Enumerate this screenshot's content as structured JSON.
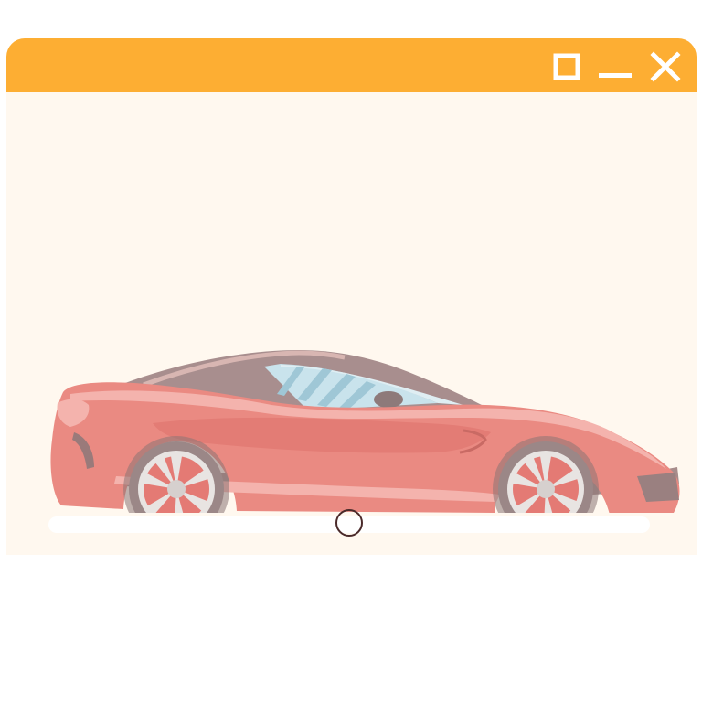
{
  "window": {
    "titlebar_color": "#fdae33",
    "background_color": "#fff8ef",
    "controls": [
      {
        "name": "maximize",
        "icon": "square-icon"
      },
      {
        "name": "minimize",
        "icon": "minus-icon"
      },
      {
        "name": "close",
        "icon": "x-icon"
      }
    ]
  },
  "content": {
    "image": "red-sports-car-side-view",
    "car_color": "#ea8a82"
  },
  "slider": {
    "value": 0.5,
    "track_color": "#ffffff",
    "thumb_border_color": "#4a2a2a"
  }
}
